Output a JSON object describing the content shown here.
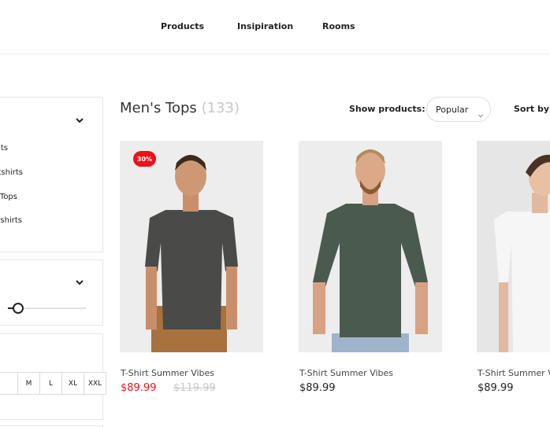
{
  "nav": {
    "items": [
      "Products",
      "Insipiration",
      "Rooms"
    ]
  },
  "sidebar": {
    "categories": [
      "ts",
      "tshirts",
      "Tops",
      "shirts"
    ],
    "sizes": [
      "M",
      "L",
      "XL",
      "XXL"
    ],
    "price_slider_value": 0.13
  },
  "listing": {
    "title": "Men's Tops",
    "count": "(133)",
    "show_label": "Show products:",
    "show_value": "Popular",
    "sort_label": "Sort by:"
  },
  "products": [
    {
      "name": "T-Shirt Summer Vibes",
      "price": "$89.99",
      "old_price": "$119.99",
      "badge": "30%",
      "shirt_color": "#4a4a48"
    },
    {
      "name": "T-Shirt Summer Vibes",
      "price": "$89.99",
      "shirt_color": "#4b5a4e"
    },
    {
      "name": "T-Shirt Summer V",
      "price": "$89.99",
      "shirt_color": "#f4f4f4"
    }
  ],
  "colors": {
    "accent": "#e8131b",
    "muted": "#c8c8c8",
    "text": "#222222"
  }
}
